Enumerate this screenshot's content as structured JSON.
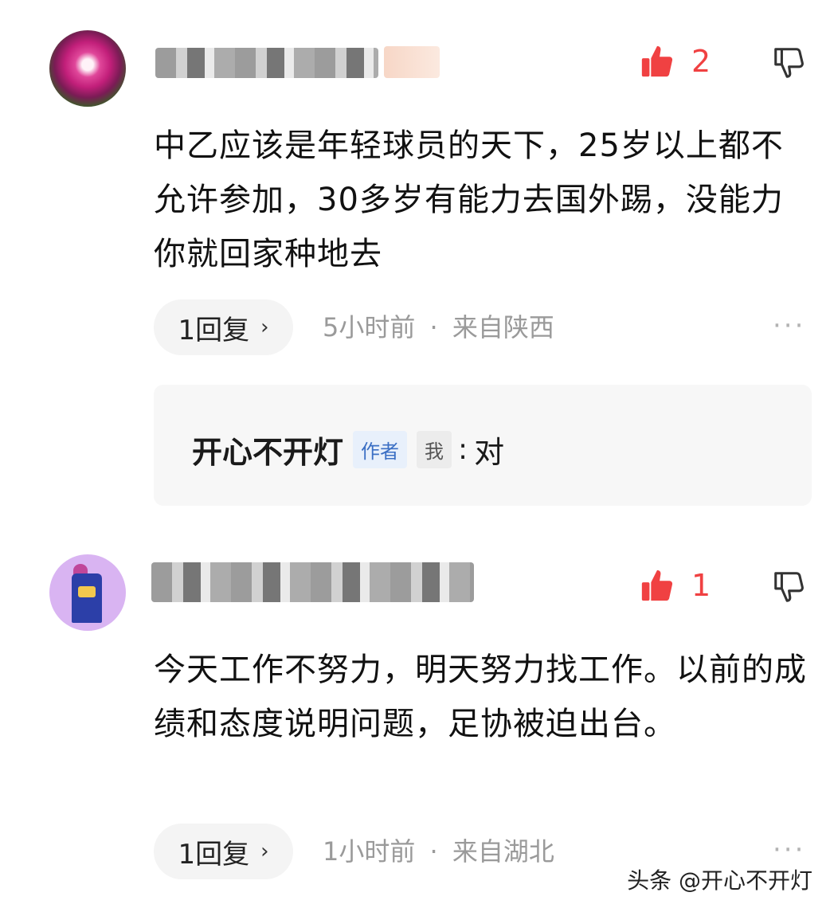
{
  "comments": [
    {
      "like_count": "2",
      "text": "中乙应该是年轻球员的天下，25岁以上都不允许参加，30多岁有能力去国外踢，没能力你就回家种地去",
      "reply_label": "1回复",
      "time": "5小时前",
      "location": "来自陕西",
      "more": "···",
      "reply": {
        "name": "开心不开灯",
        "author_tag": "作者",
        "me_tag": "我",
        "colon": ":",
        "content": "对"
      }
    },
    {
      "like_count": "1",
      "text": "今天工作不努力，明天努力找工作。以前的成绩和态度说明问题，足协被迫出台。",
      "reply_label": "1回复",
      "time": "1小时前",
      "location": "来自湖北",
      "more": "···"
    }
  ],
  "meta_separator": "·",
  "reply_chevron": "›",
  "watermark": "头条 @开心不开灯",
  "colors": {
    "like": "#f04142",
    "meta": "#9a9a9a",
    "author_tag": "#3b6fc4"
  },
  "icons": [
    "thumbs-up-icon",
    "thumbs-down-icon",
    "chevron-right-icon",
    "more-icon"
  ]
}
